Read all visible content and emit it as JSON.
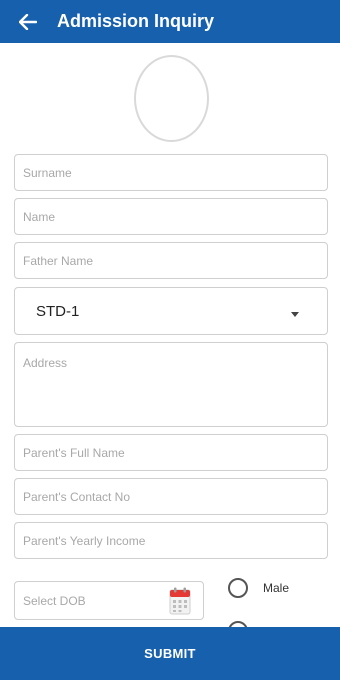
{
  "appbar": {
    "title": "Admission Inquiry",
    "back_icon": "arrow-left-icon",
    "color": "#1760ad"
  },
  "avatar": {
    "icon": "profile-photo-placeholder"
  },
  "form": {
    "surname": {
      "placeholder": "Surname",
      "value": ""
    },
    "name": {
      "placeholder": "Name",
      "value": ""
    },
    "father_name": {
      "placeholder": "Father Name",
      "value": ""
    },
    "standard": {
      "selected": "STD-1"
    },
    "address": {
      "placeholder": "Address",
      "value": ""
    },
    "parent_full_name": {
      "placeholder": "Parent's Full Name",
      "value": ""
    },
    "parent_contact": {
      "placeholder": "Parent's Contact No",
      "value": ""
    },
    "parent_income": {
      "placeholder": "Parent's Yearly Income",
      "value": ""
    },
    "dob": {
      "placeholder": "Select DOB",
      "icon": "calendar-icon"
    },
    "gender": {
      "options": [
        "Male"
      ]
    }
  },
  "submit_label": "SUBMIT"
}
